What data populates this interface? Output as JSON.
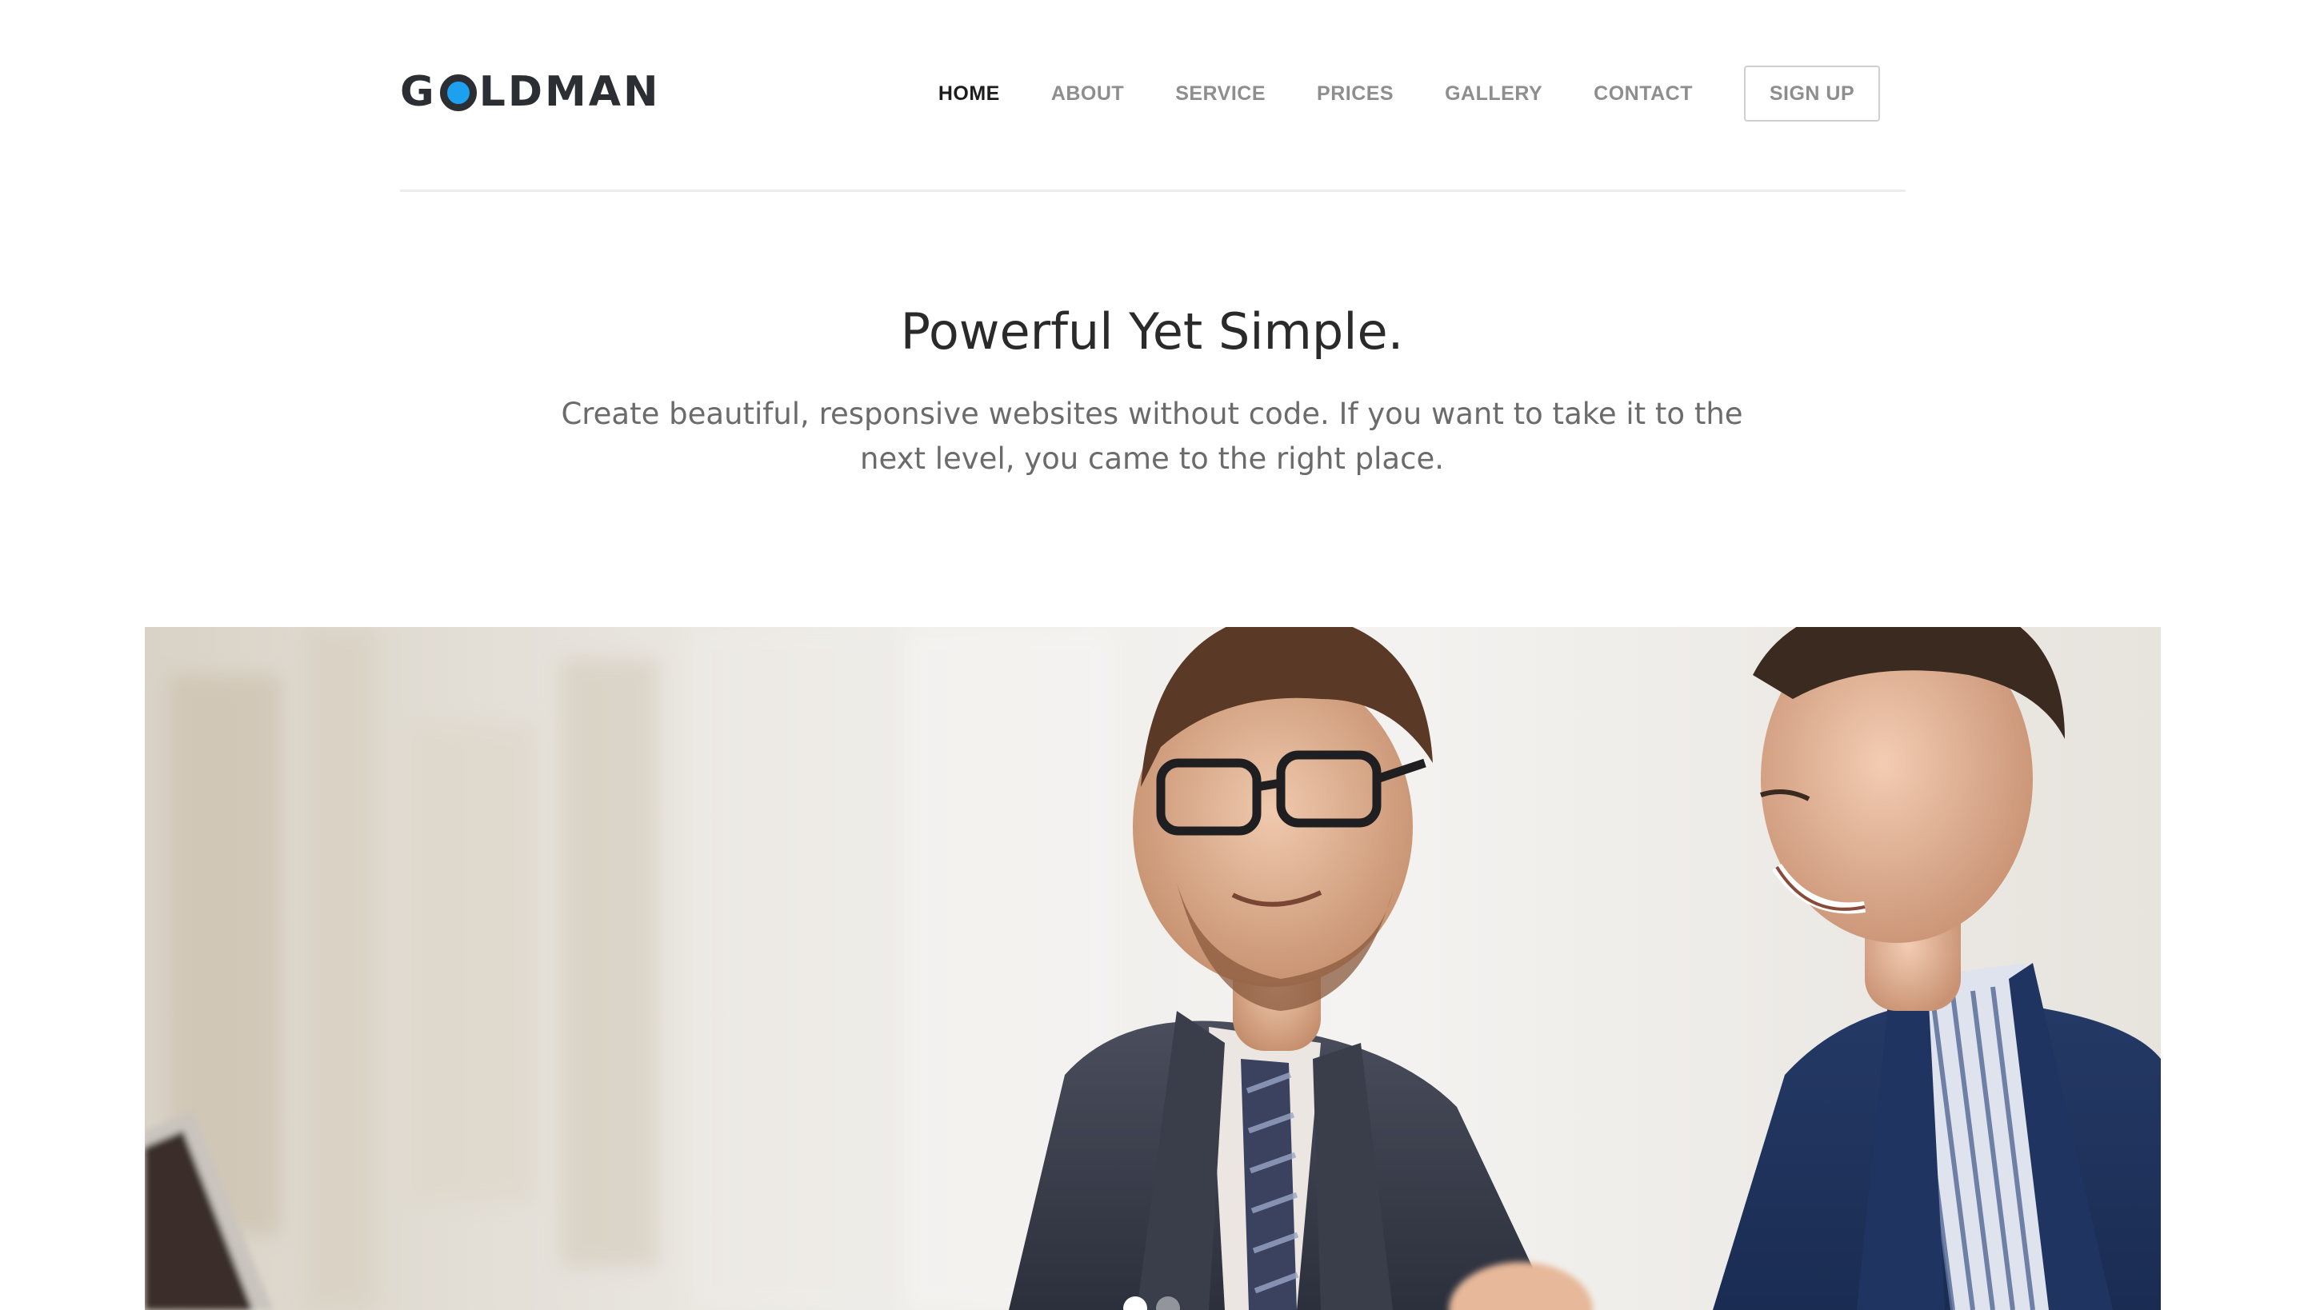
{
  "header": {
    "logo": {
      "before": "G",
      "after": "LDMAN",
      "accent_color": "#1ea0f0"
    },
    "nav": [
      {
        "label": "HOME",
        "active": true
      },
      {
        "label": "ABOUT",
        "active": false
      },
      {
        "label": "SERVICE",
        "active": false
      },
      {
        "label": "PRICES",
        "active": false
      },
      {
        "label": "GALLERY",
        "active": false
      },
      {
        "label": "CONTACT",
        "active": false
      }
    ],
    "signup_label": "SIGN UP"
  },
  "hero": {
    "title": "Powerful Yet Simple.",
    "subtitle": "Create beautiful, responsive websites without code. If you want to take it to the next level, you came to the right place."
  },
  "slider": {
    "image": "two-businessmen-looking-at-laptop-photo",
    "slide_count": 2,
    "active_slide": 1
  },
  "colors": {
    "nav_active": "#1d1d1d",
    "nav_inactive": "#8e8e8e",
    "title": "#2a2a2a",
    "subtitle": "#6b6b6b"
  }
}
